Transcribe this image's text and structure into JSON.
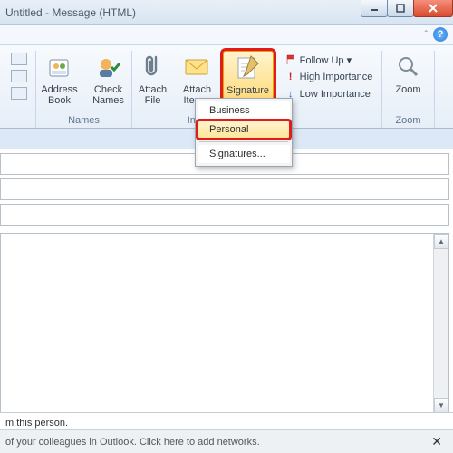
{
  "window": {
    "title": "Untitled - Message (HTML)"
  },
  "ribbon": {
    "groups": {
      "names": {
        "label": "Names",
        "address_book": "Address\nBook",
        "check_names": "Check\nNames"
      },
      "include": {
        "label": "Include",
        "attach_file": "Attach\nFile",
        "attach_item": "Attach\nItem ▾",
        "signature": "Signature\n▾"
      },
      "tags": {
        "follow_up": "Follow Up ▾",
        "high": "High Importance",
        "low": "Low Importance"
      },
      "zoom": {
        "label": "Zoom",
        "zoom": "Zoom"
      }
    }
  },
  "signature_menu": {
    "business": "Business",
    "personal": "Personal",
    "signatures": "Signatures..."
  },
  "status": {
    "line1": "m this person.",
    "line2": "of your colleagues in Outlook. Click here to add networks."
  }
}
